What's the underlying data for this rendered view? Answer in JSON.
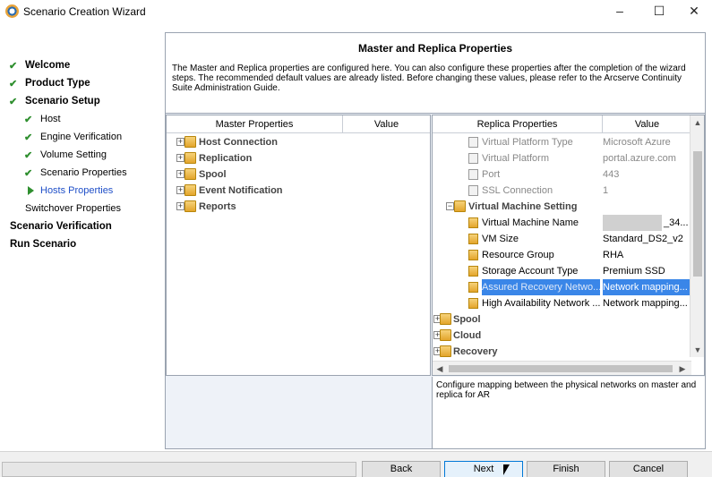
{
  "window": {
    "title": "Scenario Creation Wizard",
    "minimize": "–",
    "maximize": "☐",
    "close": "✕"
  },
  "steps": [
    {
      "label": "Welcome",
      "state": "done",
      "bold": true
    },
    {
      "label": "Product Type",
      "state": "done",
      "bold": true
    },
    {
      "label": "Scenario Setup",
      "state": "done",
      "bold": true
    },
    {
      "label": "Host",
      "state": "done",
      "bold": false
    },
    {
      "label": "Engine Verification",
      "state": "done",
      "bold": false
    },
    {
      "label": "Volume Setting",
      "state": "done",
      "bold": false
    },
    {
      "label": "Scenario Properties",
      "state": "done",
      "bold": false
    },
    {
      "label": "Hosts Properties",
      "state": "current",
      "bold": false
    },
    {
      "label": "Switchover Properties",
      "state": "pending",
      "bold": false
    },
    {
      "label": "Scenario Verification",
      "state": "pending",
      "bold": true
    },
    {
      "label": "Run Scenario",
      "state": "pending",
      "bold": true
    }
  ],
  "header": {
    "title": "Master and Replica Properties",
    "description": "The Master and Replica properties are configured here. You can also configure these properties after the completion of the wizard steps. The recommended default values are already listed. Before changing these values, please refer to the Arcserve Continuity Suite Administration Guide."
  },
  "master": {
    "col_name": "Master Properties",
    "col_value": "Value",
    "groups": [
      "Host Connection",
      "Replication",
      "Spool",
      "Event Notification",
      "Reports"
    ]
  },
  "replica": {
    "col_name": "Replica Properties",
    "col_value": "Value",
    "rows": [
      {
        "name": "Virtual Platform Type",
        "value": "Microsoft Azure",
        "kind": "readonly"
      },
      {
        "name": "Virtual Platform",
        "value": "portal.azure.com",
        "kind": "readonly"
      },
      {
        "name": "Port",
        "value": "443",
        "kind": "readonly"
      },
      {
        "name": "SSL Connection",
        "value": "1",
        "kind": "readonly"
      }
    ],
    "vm_group": "Virtual Machine Setting",
    "vm_rows": [
      {
        "name": "Virtual Machine Name",
        "value": "_34..."
      },
      {
        "name": "VM Size",
        "value": "Standard_DS2_v2"
      },
      {
        "name": "Resource Group",
        "value": "RHA"
      },
      {
        "name": "Storage Account Type",
        "value": "Premium SSD"
      },
      {
        "name": "Assured Recovery Netwo...",
        "value": "Network mapping..."
      },
      {
        "name": "High Availability Network ...",
        "value": "Network mapping..."
      }
    ],
    "groups": [
      "Spool",
      "Cloud",
      "Recovery"
    ]
  },
  "description": "Configure mapping between the physical networks on master and replica for AR",
  "buttons": {
    "back": "Back",
    "next": "Next",
    "finish": "Finish",
    "cancel": "Cancel"
  },
  "colors": {
    "check": "#2f8f2f",
    "current": "#1f4fc8",
    "selection": "#3a86e8"
  }
}
